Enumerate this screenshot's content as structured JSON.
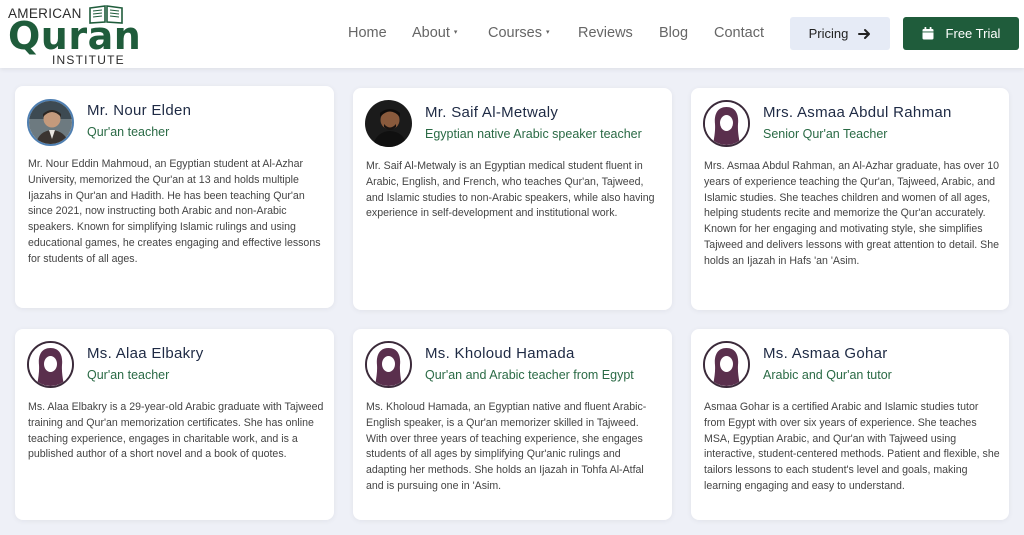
{
  "brand": {
    "line1": "AMERICAN",
    "line2": "Quran",
    "line3": "INSTITUTE",
    "color": "#1f5c3b"
  },
  "nav": {
    "items": [
      {
        "label": "Home"
      },
      {
        "label": "About",
        "caret": "▾"
      },
      {
        "label": "Courses",
        "caret": "▾"
      },
      {
        "label": "Reviews"
      },
      {
        "label": "Blog"
      },
      {
        "label": "Contact"
      }
    ],
    "pricing_label": "Pricing",
    "pricing_icon": "arrow-right-icon",
    "trial_label": "Free Trial",
    "trial_icon": "calendar-icon"
  },
  "teachers": [
    {
      "name": "Mr. Nour Elden",
      "role": "Qur'an teacher",
      "avatar": "male-photo",
      "bio": "Mr. Nour Eddin Mahmoud, an Egyptian student at Al-Azhar University, memorized the Qur'an at 13 and holds multiple Ijazahs in Qur'an and Hadith. He has been teaching Qur'an since 2021, now instructing both Arabic and non-Arabic speakers. Known for simplifying Islamic rulings and using educational games, he creates engaging and effective lessons for students of all ages."
    },
    {
      "name": "Mr. Saif Al-Metwaly",
      "role": "Egyptian native Arabic speaker teacher",
      "avatar": "male-photo",
      "bio": "Mr. Saif Al-Metwaly is an Egyptian medical student fluent in Arabic, English, and French, who teaches Qur'an, Tajweed, and Islamic studies to non-Arabic speakers, while also having experience in self-development and institutional work."
    },
    {
      "name": "Mrs. Asmaa Abdul Rahman",
      "role": "Senior Qur'an Teacher",
      "avatar": "female-silhouette-icon",
      "bio": "Mrs. Asmaa Abdul Rahman, an Al-Azhar graduate, has over 10 years of experience teaching the Qur'an, Tajweed, Arabic, and Islamic studies. She teaches children and women of all ages, helping students recite and memorize the Qur'an accurately. Known for her engaging and motivating style, she simplifies Tajweed and delivers lessons with great attention to detail. She holds an Ijazah in Hafs 'an 'Asim."
    },
    {
      "name": "Ms. Alaa Elbakry",
      "role": "Qur'an teacher",
      "avatar": "female-silhouette-icon",
      "bio": "Ms. Alaa Elbakry is a 29-year-old Arabic graduate with Tajweed training and Qur'an memorization certificates. She has online teaching experience, engages in charitable work, and is a published author of a short novel and a book of quotes."
    },
    {
      "name": "Ms. Kholoud Hamada",
      "role": "Qur'an and Arabic teacher from Egypt",
      "avatar": "female-silhouette-icon",
      "bio": "Ms. Kholoud Hamada, an Egyptian native and fluent Arabic-English speaker, is a Qur'an memorizer skilled in Tajweed. With over three years of teaching experience, she engages students of all ages by simplifying Qur'anic rulings and adapting her methods. She holds an Ijazah in Tohfa Al-Atfal and is pursuing one in 'Asim."
    },
    {
      "name": "Ms. Asmaa Gohar",
      "role": "Arabic and Qur'an tutor",
      "avatar": "female-silhouette-icon",
      "bio": "Asmaa Gohar is a certified Arabic and Islamic studies tutor from Egypt with over six years of experience. She teaches MSA, Egyptian Arabic, and Qur'an with Tajweed using interactive, student-centered methods. Patient and flexible, she tailors lessons to each student's level and goals, making learning engaging and easy to understand."
    }
  ]
}
